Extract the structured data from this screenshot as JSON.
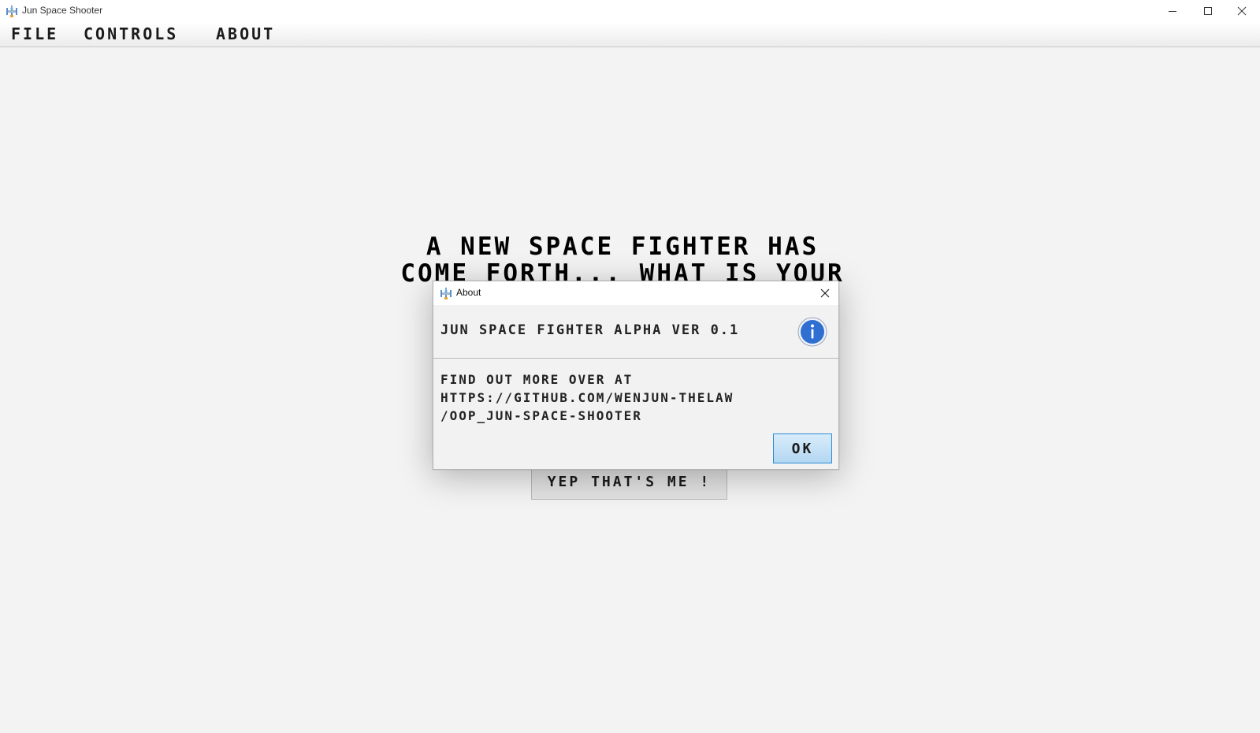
{
  "window": {
    "title": "Jun Space Shooter",
    "icon": "spaceship-icon",
    "controls": [
      "minimize-icon",
      "maximize-icon",
      "close-icon"
    ]
  },
  "menubar": {
    "items": [
      {
        "label": "FILE"
      },
      {
        "label": "CONTROLS"
      },
      {
        "label": "ABOUT"
      }
    ]
  },
  "main": {
    "headline_line1": "A NEW SPACE FIGHTER HAS",
    "headline_line2": "COME FORTH... WHAT IS YOUR",
    "confirm_button": "YEP THAT'S ME !"
  },
  "dialog": {
    "title": "About",
    "heading": "JUN SPACE FIGHTER ALPHA VER 0.1",
    "message_lines": [
      "FIND OUT MORE OVER AT",
      "HTTPS://GITHUB.COM/WENJUN-THELAW",
      "/OOP_JUN-SPACE-SHOOTER"
    ],
    "ok_label": "OK",
    "icon": "info-icon",
    "colors": {
      "info_blue": "#2f6fd1",
      "ok_border": "#2a8ad4"
    }
  }
}
